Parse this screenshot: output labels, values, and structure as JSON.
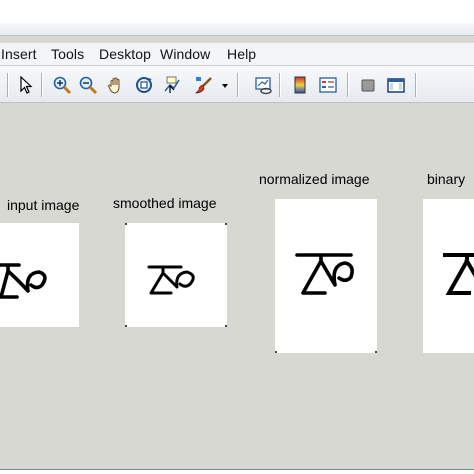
{
  "menu": {
    "items": [
      "Insert",
      "Tools",
      "Desktop",
      "Window",
      "Help"
    ]
  },
  "toolbar": {
    "icons": [
      "select-arrow-icon",
      "zoom-in-icon",
      "zoom-out-icon",
      "pan-hand-icon",
      "rotate-3d-icon",
      "data-cursor-icon",
      "brush-icon",
      "brush-dropdown-icon",
      "link-plot-icon",
      "colorbar-icon",
      "legend-icon",
      "hide-plot-tools-icon",
      "show-plot-tools-icon"
    ]
  },
  "panels": [
    {
      "title": "input image"
    },
    {
      "title": "smoothed image"
    },
    {
      "title": "normalized image"
    },
    {
      "title": "binary"
    }
  ]
}
